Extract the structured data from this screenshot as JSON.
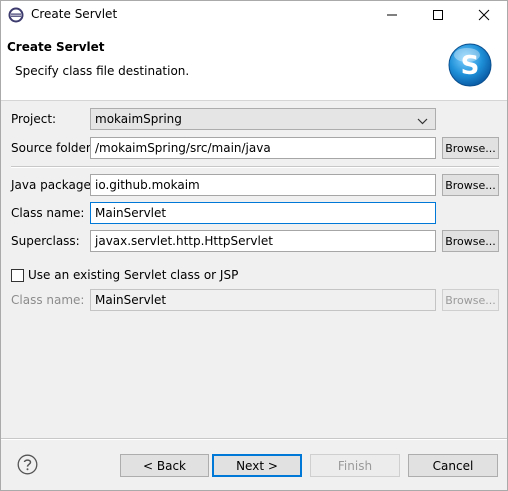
{
  "window": {
    "title": "Create Servlet",
    "controls": [
      "minimize",
      "maximize",
      "close"
    ]
  },
  "header": {
    "title": "Create Servlet",
    "description": "Specify class file destination.",
    "logo_letter": "S"
  },
  "form": {
    "project": {
      "label": "Project:",
      "value": "mokaimSpring"
    },
    "source_folder": {
      "label": "Source folder:",
      "value": "/mokaimSpring/src/main/java",
      "browse": "Browse..."
    },
    "java_package": {
      "label": "Java package:",
      "value": "io.github.mokaim",
      "browse": "Browse..."
    },
    "class_name": {
      "label": "Class name:",
      "value": "MainServlet"
    },
    "superclass": {
      "label": "Superclass:",
      "value": "javax.servlet.http.HttpServlet",
      "browse": "Browse..."
    },
    "use_existing": {
      "label": "Use an existing Servlet class or JSP",
      "checked": false
    },
    "existing_class": {
      "label": "Class name:",
      "value": "MainServlet",
      "browse": "Browse..."
    }
  },
  "footer": {
    "back": "< Back",
    "next": "Next >",
    "finish": "Finish",
    "cancel": "Cancel"
  },
  "colors": {
    "focus": "#0078d7",
    "logo_blue": "#1e90d8"
  }
}
